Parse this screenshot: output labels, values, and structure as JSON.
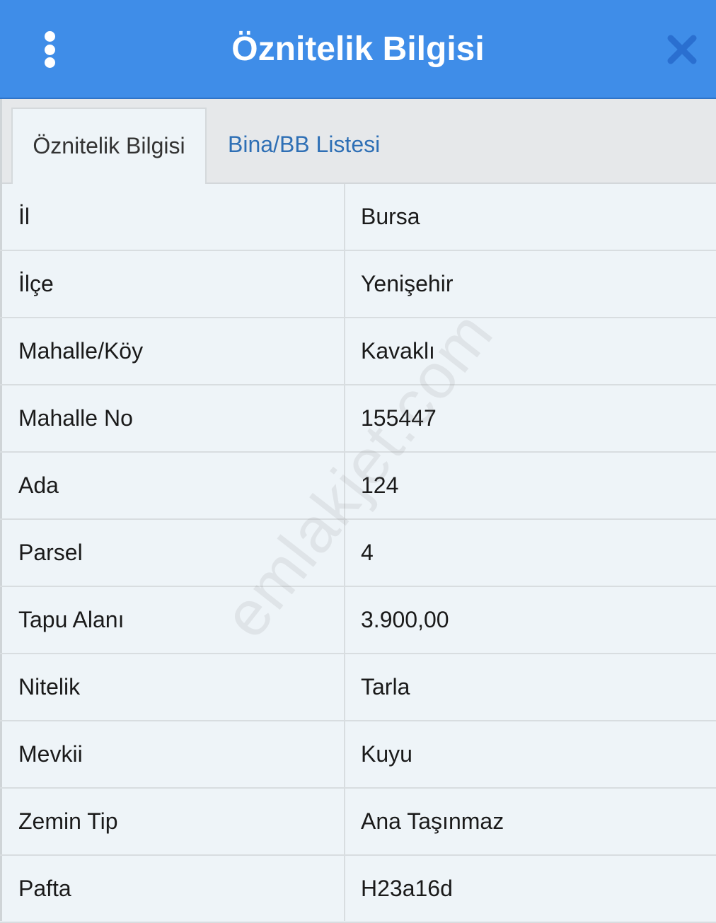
{
  "header": {
    "title": "Öznitelik Bilgisi"
  },
  "tabs": [
    {
      "label": "Öznitelik Bilgisi",
      "active": true
    },
    {
      "label": "Bina/BB Listesi",
      "active": false
    }
  ],
  "rows": [
    {
      "key": "İl",
      "value": "Bursa"
    },
    {
      "key": "İlçe",
      "value": "Yenişehir"
    },
    {
      "key": "Mahalle/Köy",
      "value": "Kavaklı"
    },
    {
      "key": "Mahalle No",
      "value": "155447"
    },
    {
      "key": "Ada",
      "value": "124"
    },
    {
      "key": "Parsel",
      "value": "4"
    },
    {
      "key": "Tapu Alanı",
      "value": "3.900,00"
    },
    {
      "key": "Nitelik",
      "value": "Tarla"
    },
    {
      "key": "Mevkii",
      "value": "Kuyu"
    },
    {
      "key": "Zemin Tip",
      "value": "Ana Taşınmaz"
    },
    {
      "key": "Pafta",
      "value": "H23a16d"
    }
  ],
  "watermark": "emlakjet.com",
  "colors": {
    "header_bg": "#3f8de8",
    "tab_inactive_text": "#2e6fb5",
    "close_icon": "#2a6fd0"
  }
}
